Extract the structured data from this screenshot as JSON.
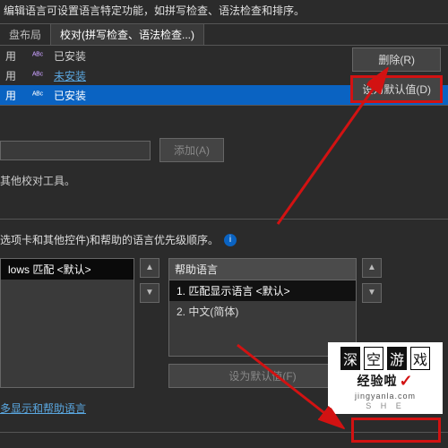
{
  "header": {
    "partial_text": "编辑语言可设置语言特定功能，如拼写检查、语法检查和排序。"
  },
  "tabs": {
    "layout": "盘布局",
    "proof": "校对(拼写检查、语法检查...)"
  },
  "rows": [
    {
      "enable": "用",
      "status": "已安装",
      "link": false,
      "selected": false
    },
    {
      "enable": "用",
      "status": "未安装",
      "link": true,
      "selected": false
    },
    {
      "enable": "用",
      "status": "已安装",
      "link": false,
      "selected": true
    }
  ],
  "buttons": {
    "remove": "删除(R)",
    "set_default": "设为默认值(D)",
    "add": "添加(A)",
    "set_default_f": "设为默认值(F)"
  },
  "notes": {
    "other_tools": "其他校对工具。",
    "priority": "选项卡和其他控件)和帮助的语言优先级顺序。"
  },
  "left_list": {
    "item1": "lows 匹配 <默认>"
  },
  "right_list": {
    "header": "帮助语言",
    "item1": "1.   匹配显示语言 <默认>",
    "item2": "2.   中文(简体)"
  },
  "arrows": {
    "up": "▲",
    "down": "▼"
  },
  "links": {
    "more_lang": "多显示和帮助语言"
  },
  "info_icon": "i",
  "logo": {
    "c1": "深",
    "c2": "空",
    "c3": "游",
    "c4": "戏",
    "sub": "经验啦",
    "check": "✓",
    "tiny": "jingyanla.com",
    "shen": "S   H   E"
  }
}
